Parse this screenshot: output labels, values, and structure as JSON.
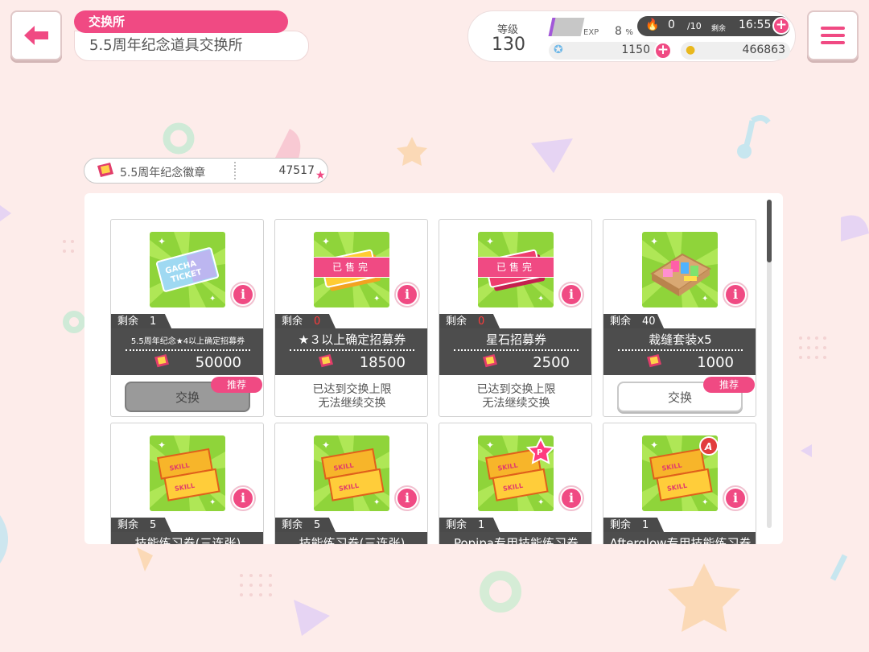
{
  "header": {
    "title_tab": "交换所",
    "title_main": "5.5周年纪念道具交换所"
  },
  "status": {
    "level_label": "等级",
    "level": "130",
    "exp_label": "EXP",
    "exp_percent": "8",
    "exp_unit": "%",
    "stamina": "0",
    "stamina_max": "/10",
    "remaining_label": "剩余",
    "time": "16:55",
    "stars": "1150",
    "coins": "466863"
  },
  "badge": {
    "name": "5.5周年纪念徽章",
    "count": "47517"
  },
  "colors": {
    "accent": "#f04a83",
    "dark_band": "#4d4d4d",
    "background": "#fdecea"
  },
  "items": [
    {
      "remaining_label": "剩余",
      "remaining": "1",
      "name": "5.5周年纪念★4以上确定招募券",
      "cost": "50000",
      "button": "交换",
      "button_style": "gray",
      "recommend": "推荐",
      "limit_line1": "",
      "limit_line2": "",
      "sold_out": "",
      "icon": "gacha-ticket-icon"
    },
    {
      "remaining_label": "剩余",
      "remaining": "0",
      "name": "★３以上确定招募券",
      "cost": "18500",
      "button": "",
      "button_style": "",
      "recommend": "",
      "limit_line1": "已达到交换上限",
      "limit_line2": "无法继续交换",
      "sold_out": "已售完",
      "icon": "gold-ticket-icon"
    },
    {
      "remaining_label": "剩余",
      "remaining": "0",
      "name": "星石招募券",
      "cost": "2500",
      "button": "",
      "button_style": "",
      "recommend": "",
      "limit_line1": "已达到交换上限",
      "limit_line2": "无法继续交换",
      "sold_out": "已售完",
      "icon": "red-ticket-icon"
    },
    {
      "remaining_label": "剩余",
      "remaining": "40",
      "name": "裁缝套装x5",
      "cost": "1000",
      "button": "交换",
      "button_style": "white",
      "recommend": "推荐",
      "limit_line1": "",
      "limit_line2": "",
      "sold_out": "",
      "icon": "sewing-kit-icon"
    },
    {
      "remaining_label": "剩余",
      "remaining": "5",
      "name": "技能练习券(三连张)",
      "icon": "skill-ticket-icon"
    },
    {
      "remaining_label": "剩余",
      "remaining": "5",
      "name": "技能练习券(三连张)",
      "icon": "skill-ticket-icon"
    },
    {
      "remaining_label": "剩余",
      "remaining": "1",
      "name": "Popipa专用技能练习券",
      "icon": "skill-ticket-popipa-icon"
    },
    {
      "remaining_label": "剩余",
      "remaining": "1",
      "name": "Afterglow专用技能练习券",
      "icon": "skill-ticket-afterglow-icon"
    }
  ]
}
